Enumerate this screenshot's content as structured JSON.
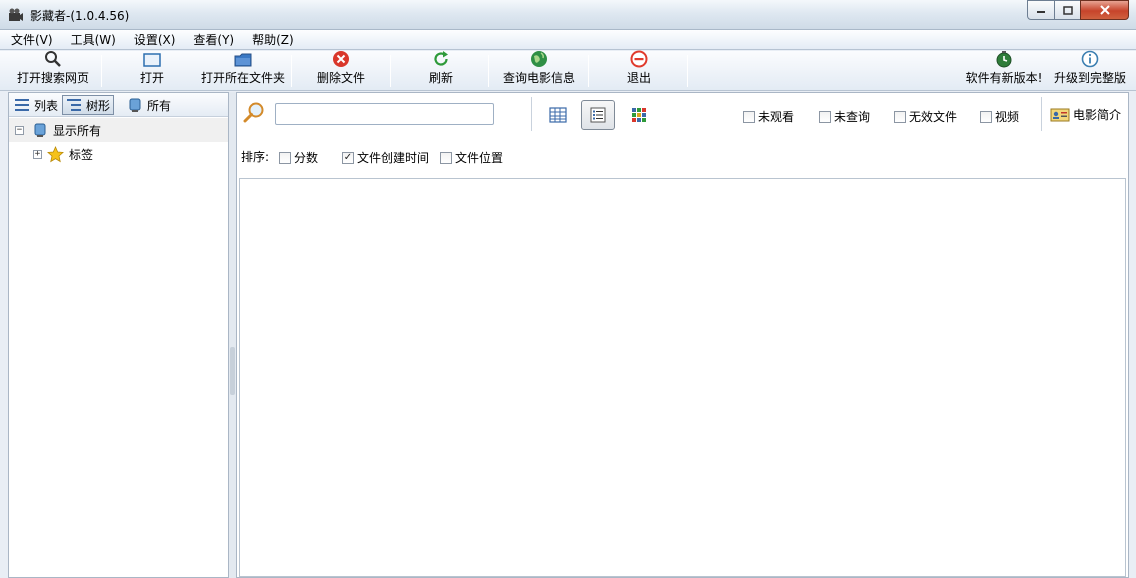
{
  "window": {
    "title": "影藏者-(1.0.4.56)",
    "controls": {
      "minimize": "─",
      "maximize": "▢",
      "close": "✕"
    }
  },
  "menu": {
    "items": [
      {
        "label": "文件(V)"
      },
      {
        "label": "工具(W)"
      },
      {
        "label": "设置(X)"
      },
      {
        "label": "查看(Y)"
      },
      {
        "label": "帮助(Z)"
      }
    ]
  },
  "toolbar": {
    "open_search": "打开搜索网页",
    "open": "打开",
    "open_folder": "打开所在文件夹",
    "delete": "删除文件",
    "refresh": "刷新",
    "query_movie": "查询电影信息",
    "exit": "退出",
    "new_version": "软件有新版本!",
    "upgrade": "升级到完整版"
  },
  "left": {
    "tabs": {
      "list": "列表",
      "tree": "树形",
      "all": "所有"
    },
    "tree": {
      "root": "显示所有",
      "child": "标签",
      "root_expander": "−",
      "child_expander": "+"
    }
  },
  "right": {
    "search": {
      "value": "",
      "placeholder": ""
    },
    "filters": {
      "unwatched": "未观看",
      "unqueried": "未查询",
      "invalid": "无效文件",
      "video": "视频",
      "movie_intro": "电影简介"
    },
    "sort": {
      "label": "排序:",
      "score": "分数",
      "created": "文件创建时间",
      "location": "文件位置",
      "created_checked": "✓"
    }
  },
  "colors": {
    "accent": "#3c7fb1",
    "delete_red": "#d9372b",
    "refresh_green": "#2e9a3a",
    "exit_red": "#e03a2c"
  }
}
